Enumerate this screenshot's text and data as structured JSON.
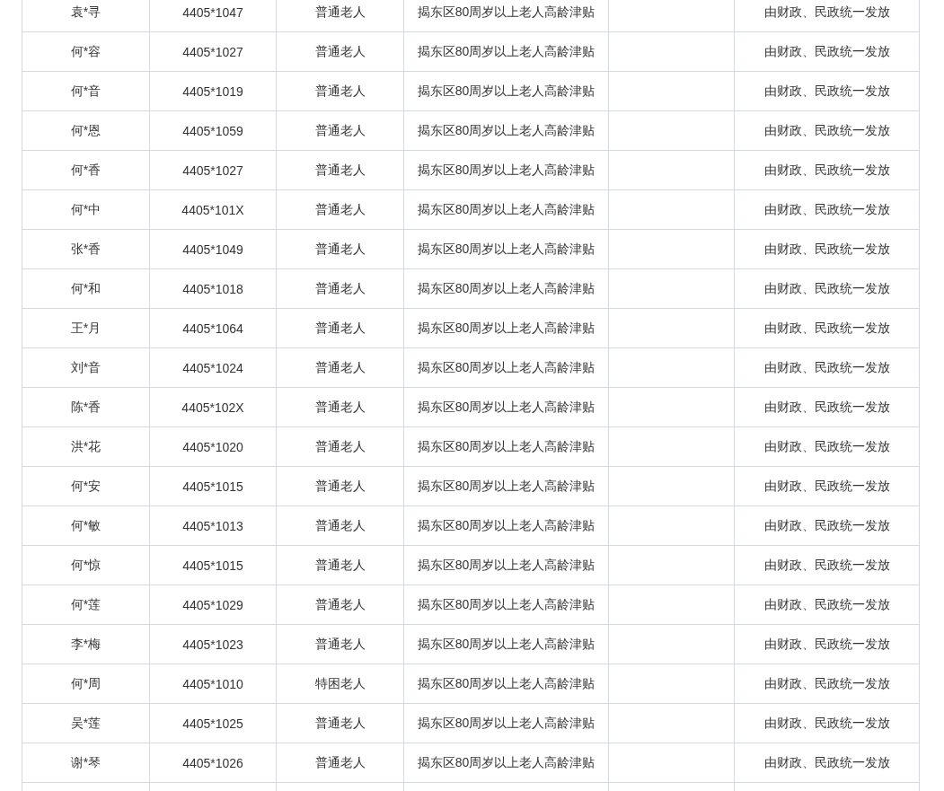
{
  "table": {
    "rows": [
      {
        "column_1": "袁*寻",
        "column_2": "4405*1047",
        "column_3": "普通老人",
        "column_4": "揭东区80周岁以上老人高龄津贴",
        "column_6": "由财政、民政统一发放"
      },
      {
        "column_1": "何*容",
        "column_2": "4405*1027",
        "column_3": "普通老人",
        "column_4": "揭东区80周岁以上老人高龄津贴",
        "column_6": "由财政、民政统一发放"
      },
      {
        "column_1": "何*音",
        "column_2": "4405*1019",
        "column_3": "普通老人",
        "column_4": "揭东区80周岁以上老人高龄津贴",
        "column_6": "由财政、民政统一发放"
      },
      {
        "column_1": "何*恩",
        "column_2": "4405*1059",
        "column_3": "普通老人",
        "column_4": "揭东区80周岁以上老人高龄津贴",
        "column_6": "由财政、民政统一发放"
      },
      {
        "column_1": "何*香",
        "column_2": "4405*1027",
        "column_3": "普通老人",
        "column_4": "揭东区80周岁以上老人高龄津贴",
        "column_6": "由财政、民政统一发放"
      },
      {
        "column_1": "何*中",
        "column_2": "4405*101X",
        "column_3": "普通老人",
        "column_4": "揭东区80周岁以上老人高龄津贴",
        "column_6": "由财政、民政统一发放"
      },
      {
        "column_1": "张*香",
        "column_2": "4405*1049",
        "column_3": "普通老人",
        "column_4": "揭东区80周岁以上老人高龄津贴",
        "column_6": "由财政、民政统一发放"
      },
      {
        "column_1": "何*和",
        "column_2": "4405*1018",
        "column_3": "普通老人",
        "column_4": "揭东区80周岁以上老人高龄津贴",
        "column_6": "由财政、民政统一发放"
      },
      {
        "column_1": "王*月",
        "column_2": "4405*1064",
        "column_3": "普通老人",
        "column_4": "揭东区80周岁以上老人高龄津贴",
        "column_6": "由财政、民政统一发放"
      },
      {
        "column_1": "刘*音",
        "column_2": "4405*1024",
        "column_3": "普通老人",
        "column_4": "揭东区80周岁以上老人高龄津贴",
        "column_6": "由财政、民政统一发放"
      },
      {
        "column_1": "陈*香",
        "column_2": "4405*102X",
        "column_3": "普通老人",
        "column_4": "揭东区80周岁以上老人高龄津贴",
        "column_6": "由财政、民政统一发放"
      },
      {
        "column_1": "洪*花",
        "column_2": "4405*1020",
        "column_3": "普通老人",
        "column_4": "揭东区80周岁以上老人高龄津贴",
        "column_6": "由财政、民政统一发放"
      },
      {
        "column_1": "何*安",
        "column_2": "4405*1015",
        "column_3": "普通老人",
        "column_4": "揭东区80周岁以上老人高龄津贴",
        "column_6": "由财政、民政统一发放"
      },
      {
        "column_1": "何*敏",
        "column_2": "4405*1013",
        "column_3": "普通老人",
        "column_4": "揭东区80周岁以上老人高龄津贴",
        "column_6": "由财政、民政统一发放"
      },
      {
        "column_1": "何*惊",
        "column_2": "4405*1015",
        "column_3": "普通老人",
        "column_4": "揭东区80周岁以上老人高龄津贴",
        "column_6": "由财政、民政统一发放"
      },
      {
        "column_1": "何*莲",
        "column_2": "4405*1029",
        "column_3": "普通老人",
        "column_4": "揭东区80周岁以上老人高龄津贴",
        "column_6": "由财政、民政统一发放"
      },
      {
        "column_1": "李*梅",
        "column_2": "4405*1023",
        "column_3": "普通老人",
        "column_4": "揭东区80周岁以上老人高龄津贴",
        "column_6": "由财政、民政统一发放"
      },
      {
        "column_1": "何*周",
        "column_2": "4405*1010",
        "column_3": "特困老人",
        "column_4": "揭东区80周岁以上老人高龄津贴",
        "column_6": "由财政、民政统一发放"
      },
      {
        "column_1": "吴*莲",
        "column_2": "4405*1025",
        "column_3": "普通老人",
        "column_4": "揭东区80周岁以上老人高龄津贴",
        "column_6": "由财政、民政统一发放"
      },
      {
        "column_1": "谢*琴",
        "column_2": "4405*1026",
        "column_3": "普通老人",
        "column_4": "揭东区80周岁以上老人高龄津贴",
        "column_6": "由财政、民政统一发放"
      }
    ]
  }
}
